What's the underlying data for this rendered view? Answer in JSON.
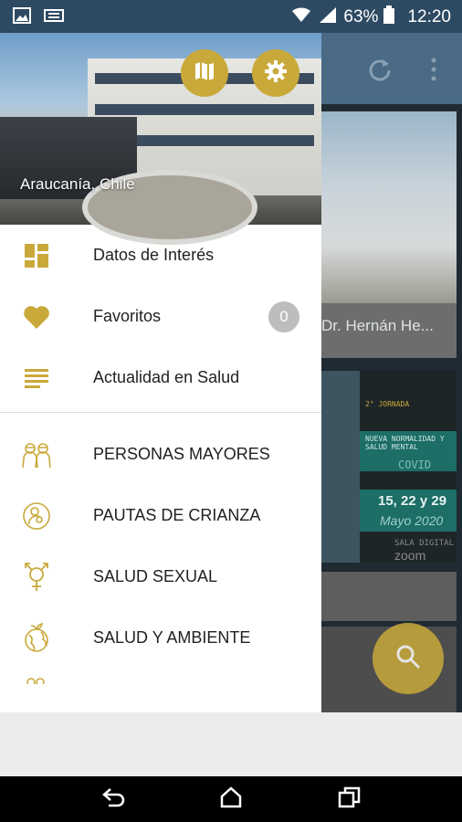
{
  "status_bar": {
    "battery": "63%",
    "time": "12:20"
  },
  "drawer": {
    "location": "Araucanía, Chile",
    "primary_items": [
      {
        "label": "Datos de Interés",
        "icon": "dashboard-icon"
      },
      {
        "label": "Favoritos",
        "icon": "heart-icon",
        "badge": "0"
      },
      {
        "label": "Actualidad en Salud",
        "icon": "notes-icon"
      }
    ],
    "category_items": [
      {
        "label": "PERSONAS MAYORES",
        "icon": "elderly-icon"
      },
      {
        "label": "PAUTAS DE CRIANZA",
        "icon": "parenting-icon"
      },
      {
        "label": "SALUD SEXUAL",
        "icon": "gender-icon"
      },
      {
        "label": "SALUD Y AMBIENTE",
        "icon": "globe-plant-icon"
      }
    ]
  },
  "background": {
    "card_title": "Dr. Hernán He...",
    "event": {
      "line1": "2° JORNADA",
      "line2": "NUEVA NORMALIDAD Y SALUD MENTAL",
      "line3": "COVID",
      "dates": "15, 22 y 29",
      "month": "Mayo 2020",
      "platform": "SALA DIGITAL",
      "app": "zoom"
    }
  },
  "colors": {
    "accent": "#c9a93a",
    "status_bar": "#2e4a63",
    "toolbar": "#4a6a85"
  }
}
